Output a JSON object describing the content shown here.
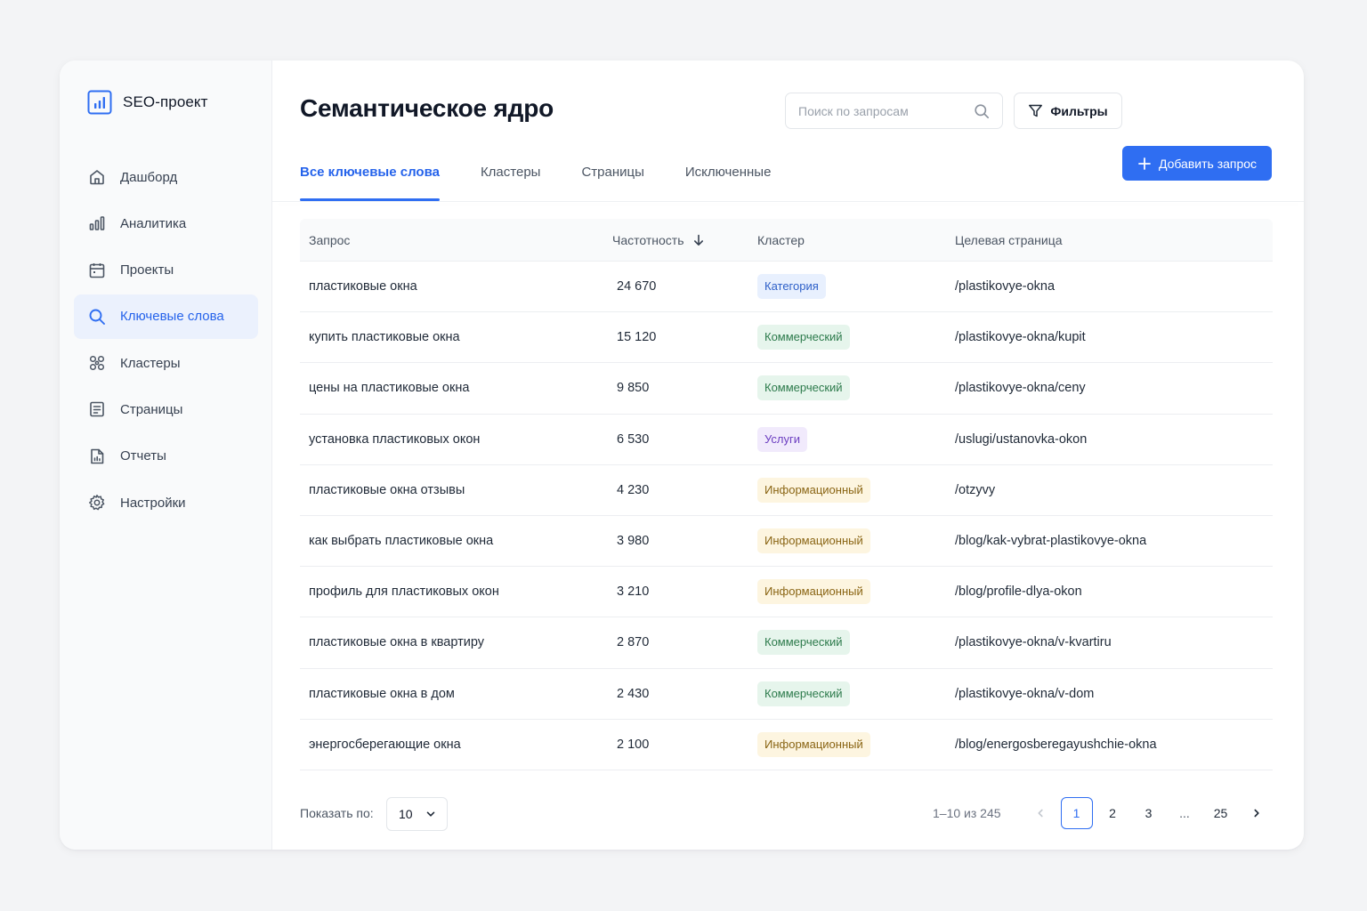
{
  "brand": {
    "name": "SEO-проект",
    "logo_icon": "bar-chart-icon"
  },
  "sidebar": {
    "items": [
      {
        "label": "Дашборд",
        "icon": "home-icon",
        "active": false
      },
      {
        "label": "Аналитика",
        "icon": "bar-chart-icon",
        "active": false
      },
      {
        "label": "Проекты",
        "icon": "calendar-icon",
        "active": false
      },
      {
        "label": "Ключевые слова",
        "icon": "search-icon",
        "active": true
      },
      {
        "label": "Кластеры",
        "icon": "cluster-icon",
        "active": false
      },
      {
        "label": "Страницы",
        "icon": "document-icon",
        "active": false
      },
      {
        "label": "Отчеты",
        "icon": "report-icon",
        "active": false
      },
      {
        "label": "Настройки",
        "icon": "gear-icon",
        "active": false
      }
    ]
  },
  "header": {
    "title": "Семантическое ядро",
    "search_placeholder": "Поиск по запросам",
    "filters_label": "Фильтры",
    "add_label": "Добавить запрос"
  },
  "tabs": [
    {
      "label": "Все ключевые слова",
      "active": true
    },
    {
      "label": "Кластеры",
      "active": false
    },
    {
      "label": "Страницы",
      "active": false
    },
    {
      "label": "Исключенные",
      "active": false
    }
  ],
  "table": {
    "columns": [
      "Запрос",
      "Частотность",
      "Кластер",
      "Целевая страница"
    ],
    "sort_column": "Частотность",
    "sort_direction": "desc",
    "rows": [
      {
        "query": "пластиковые окна",
        "frequency": "24 670",
        "cluster": "Категория",
        "cluster_type": "cat",
        "page": "/plastikovye-okna"
      },
      {
        "query": "купить пластиковые окна",
        "frequency": "15 120",
        "cluster": "Коммерческий",
        "cluster_type": "com",
        "page": "/plastikovye-okna/kupit"
      },
      {
        "query": "цены на пластиковые окна",
        "frequency": "9 850",
        "cluster": "Коммерческий",
        "cluster_type": "com",
        "page": "/plastikovye-okna/ceny"
      },
      {
        "query": "установка пластиковых окон",
        "frequency": "6 530",
        "cluster": "Услуги",
        "cluster_type": "svc",
        "page": "/uslugi/ustanovka-okon"
      },
      {
        "query": "пластиковые окна отзывы",
        "frequency": "4 230",
        "cluster": "Информационный",
        "cluster_type": "inf",
        "page": "/otzyvy"
      },
      {
        "query": "как выбрать пластиковые окна",
        "frequency": "3 980",
        "cluster": "Информационный",
        "cluster_type": "inf",
        "page": "/blog/kak-vybrat-plastikovye-okna"
      },
      {
        "query": "профиль для пластиковых окон",
        "frequency": "3 210",
        "cluster": "Информационный",
        "cluster_type": "inf",
        "page": "/blog/profile-dlya-okon"
      },
      {
        "query": "пластиковые окна в квартиру",
        "frequency": "2 870",
        "cluster": "Коммерческий",
        "cluster_type": "com",
        "page": "/plastikovye-okna/v-kvartiru"
      },
      {
        "query": "пластиковые окна в дом",
        "frequency": "2 430",
        "cluster": "Коммерческий",
        "cluster_type": "com",
        "page": "/plastikovye-okna/v-dom"
      },
      {
        "query": "энергосберегающие окна",
        "frequency": "2 100",
        "cluster": "Информационный",
        "cluster_type": "inf",
        "page": "/blog/energosberegayushchie-okna"
      }
    ]
  },
  "footer": {
    "show_label": "Показать по:",
    "page_size": "10",
    "range": "1–10 из 245",
    "pages": [
      "1",
      "2",
      "3",
      "...",
      "25"
    ],
    "current_page": "1"
  },
  "colors": {
    "accent": "#2f6ef2",
    "badge_category": "#e8f0fe",
    "badge_commercial": "#e6f5ec",
    "badge_services": "#f1eafc",
    "badge_informational": "#fdf5e0"
  }
}
